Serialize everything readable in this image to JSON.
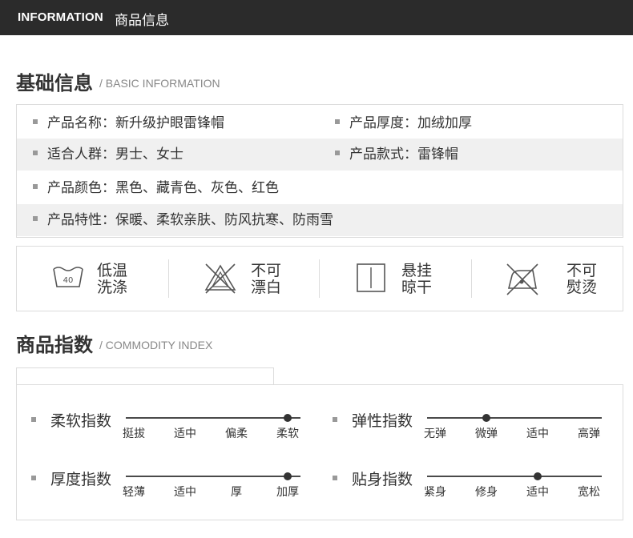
{
  "header": {
    "en": "INFORMATION",
    "cn": "商品信息"
  },
  "basic": {
    "title": "基础信息",
    "subtitle": "/ BASIC INFORMATION",
    "rows": [
      {
        "left": "产品名称：新升级护眼雷锋帽",
        "right": "产品厚度：加绒加厚"
      },
      {
        "left": "适合人群：男士、女士",
        "right": "产品款式：雷锋帽"
      },
      {
        "left": "产品颜色：黑色、藏青色、灰色、红色",
        "right": ""
      },
      {
        "left": "产品特性：保暖、柔软亲肤、防风抗寒、防雨雪",
        "right": ""
      }
    ]
  },
  "care": [
    {
      "icon": "wash-40-icon",
      "icon_text": "40",
      "line1": "低温",
      "line2": "洗涤"
    },
    {
      "icon": "no-bleach-icon",
      "line1": "不可",
      "line2": "漂白"
    },
    {
      "icon": "hang-dry-icon",
      "line1": "悬挂",
      "line2": "晾干"
    },
    {
      "icon": "no-iron-icon",
      "line1": "不可",
      "line2": "熨烫"
    }
  ],
  "commodity": {
    "title": "商品指数",
    "subtitle": "/ COMMODITY INDEX",
    "indexes": [
      {
        "name": "柔软指数",
        "labels": [
          "挺拔",
          "适中",
          "偏柔",
          "柔软"
        ],
        "selected": 3
      },
      {
        "name": "弹性指数",
        "labels": [
          "无弹",
          "微弹",
          "适中",
          "高弹"
        ],
        "selected": 1
      },
      {
        "name": "厚度指数",
        "labels": [
          "轻薄",
          "适中",
          "厚",
          "加厚"
        ],
        "selected": 3
      },
      {
        "name": "贴身指数",
        "labels": [
          "紧身",
          "修身",
          "适中",
          "宽松"
        ],
        "selected": 2
      }
    ]
  },
  "colors": {
    "header_bg": "#2b2b2b",
    "row_shade": "#f0f0f0",
    "bullet": "#999999"
  }
}
